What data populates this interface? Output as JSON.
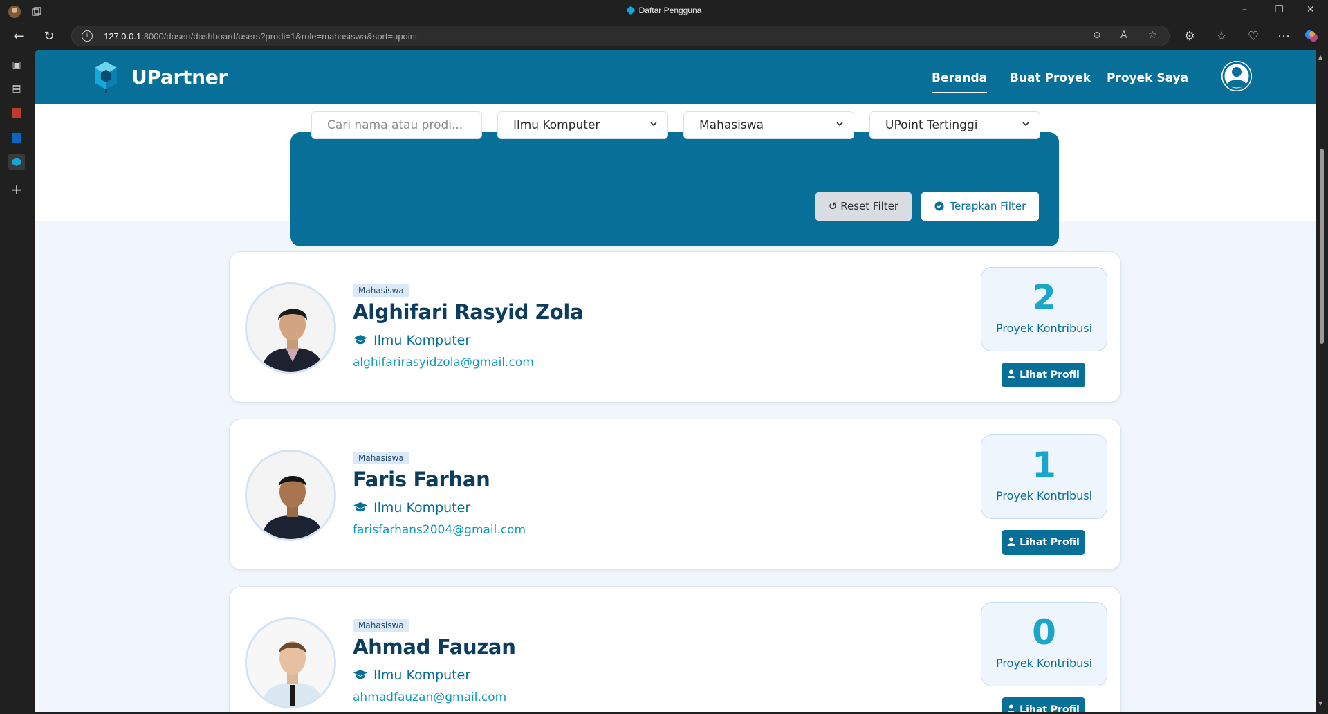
{
  "browser": {
    "tab_title": "Daftar Pengguna",
    "url_host": "127.0.0.1",
    "url_rest": ":8000/dosen/dashboard/users?prodi=1&role=mahasiswa&sort=upoint"
  },
  "app": {
    "brand": "UPartner",
    "accent_color": "#086f98",
    "nav": [
      {
        "label": "Beranda",
        "active": true
      },
      {
        "label": "Buat Proyek",
        "active": false
      },
      {
        "label": "Proyek Saya",
        "active": false
      }
    ]
  },
  "filters": {
    "search_placeholder": "Cari nama atau prodi...",
    "prodi_selected": "Ilmu Komputer",
    "role_selected": "Mahasiswa",
    "sort_selected": "UPoint Tertinggi",
    "reset_label": "Reset Filter",
    "apply_label": "Terapkan Filter"
  },
  "users": [
    {
      "role": "Mahasiswa",
      "name": "Alghifari Rasyid Zola",
      "prodi": "Ilmu Komputer",
      "email": "alghifarirasyidzola@gmail.com",
      "projects": "2",
      "projects_label": "Proyek Kontribusi",
      "profile_label": "Lihat Profil"
    },
    {
      "role": "Mahasiswa",
      "name": "Faris Farhan",
      "prodi": "Ilmu Komputer",
      "email": "farisfarhans2004@gmail.com",
      "projects": "1",
      "projects_label": "Proyek Kontribusi",
      "profile_label": "Lihat Profil"
    },
    {
      "role": "Mahasiswa",
      "name": "Ahmad Fauzan",
      "prodi": "Ilmu Komputer",
      "email": "ahmadfauzan@gmail.com",
      "projects": "0",
      "projects_label": "Proyek Kontribusi",
      "profile_label": "Lihat Profil"
    }
  ]
}
